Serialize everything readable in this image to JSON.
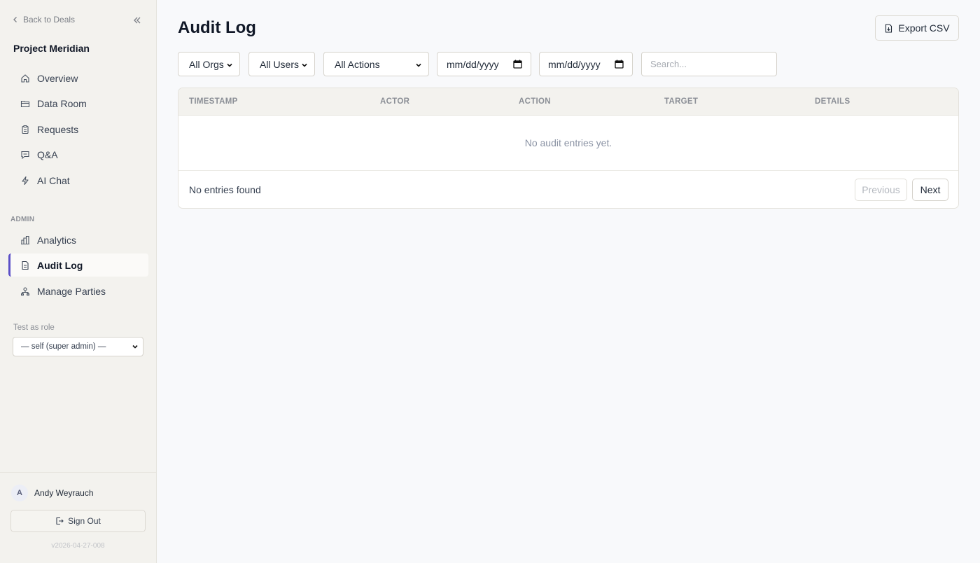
{
  "sidebar": {
    "back_label": "Back to Deals",
    "project_title": "Project Meridian",
    "nav_items": [
      {
        "label": "Overview",
        "icon": "home-icon"
      },
      {
        "label": "Data Room",
        "icon": "folder-icon"
      },
      {
        "label": "Requests",
        "icon": "clipboard-icon"
      },
      {
        "label": "Q&A",
        "icon": "chat-icon"
      },
      {
        "label": "AI Chat",
        "icon": "bolt-icon"
      }
    ],
    "admin_label": "ADMIN",
    "admin_items": [
      {
        "label": "Analytics",
        "icon": "bar-chart-icon"
      },
      {
        "label": "Audit Log",
        "icon": "document-icon",
        "active": true
      },
      {
        "label": "Manage Parties",
        "icon": "org-icon"
      }
    ],
    "role_label": "Test as role",
    "role_value": "— self (super admin) —",
    "user_initial": "A",
    "user_name": "Andy Weyrauch",
    "signout_label": "Sign Out",
    "version": "v2026-04-27-008"
  },
  "main": {
    "title": "Audit Log",
    "export_label": "Export CSV",
    "filters": {
      "orgs": "All Orgs",
      "users": "All Users",
      "actions": "All Actions",
      "date_from": "mm/dd/yyyy",
      "date_to": "mm/dd/yyyy",
      "search_placeholder": "Search..."
    },
    "table": {
      "columns": [
        "TIMESTAMP",
        "ACTOR",
        "ACTION",
        "TARGET",
        "DETAILS"
      ],
      "empty_message": "No audit entries yet.",
      "count_text": "No entries found",
      "prev_label": "Previous",
      "next_label": "Next"
    }
  },
  "colors": {
    "accent": "#5b4fc7",
    "sidebar_bg": "#f3f2ee",
    "page_bg": "#f8f9fb"
  }
}
